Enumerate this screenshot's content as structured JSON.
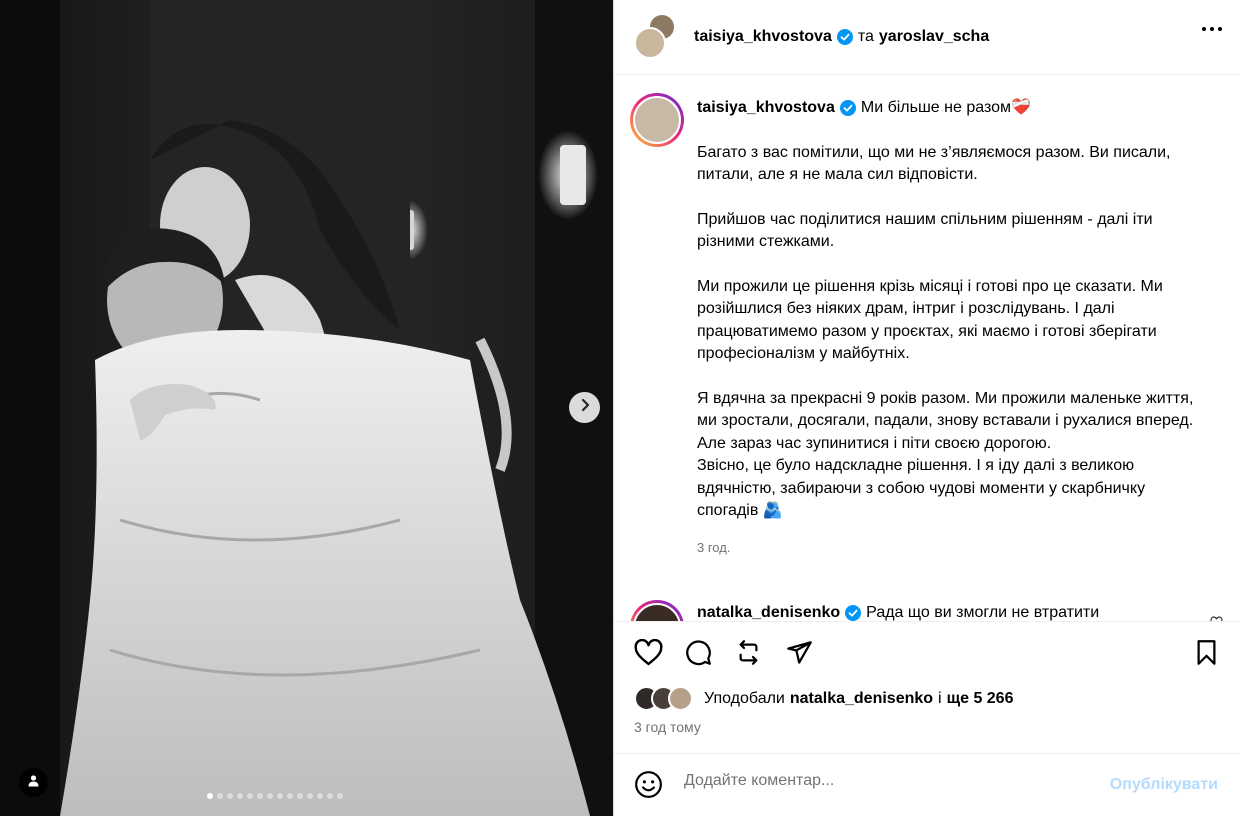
{
  "post": {
    "author": "taisiya_khvostova",
    "conjunction": "та",
    "coauthor": "yaroslav_scha"
  },
  "caption": {
    "username": "taisiya_khvostova",
    "first_line": "Ми більше не разом",
    "first_emoji": "❤️‍🩹",
    "paragraphs": [
      "Багато з вас помітили, що ми не з’являємося разом. Ви писали, питали, але я не мала сил відповісти.",
      "Прийшов час поділитися нашим спільним рішенням - далі іти різними стежками.",
      "Ми прожили це рішення крізь місяці і готові про це сказати. Ми розійшлися без ніяких драм, інтриг і розслідувань. І далі працюватимемо разом у проєктах, які маємо і готові зберігати професіоналізм у майбутніх.",
      "Я вдячна за прекрасні 9 років разом. Ми прожили маленьке життя, ми зростали, досягали, падали, знову вставали і рухалися вперед. Але зараз час зупинитися і піти своєю дорогою."
    ],
    "last_paragraph": "Звісно, це було надскладне рішення. І я іду далі з великою вдячністю, забираючи з собою чудові моменти у скарбничку спогадів",
    "last_emoji": "🫂",
    "time": "3 год."
  },
  "comment": {
    "username": "natalka_denisenko",
    "text": "Рада що ви змогли не втратити"
  },
  "likes": {
    "prefix": "Уподобали",
    "user": "natalka_denisenko",
    "mid": "і",
    "count": "ще 5 266"
  },
  "timestamp": "3 год тому",
  "comment_bar": {
    "placeholder": "Додайте коментар...",
    "post_label": "Опублікувати"
  },
  "carousel": {
    "total": 14,
    "active": 0
  },
  "colors": {
    "verified": "#0095f6",
    "post_button": "#b3dbff",
    "secondary_text": "#737373"
  },
  "icons": [
    "verified-badge-icon",
    "more-options-icon",
    "heart-icon",
    "comment-icon",
    "repost-icon",
    "share-icon",
    "bookmark-icon",
    "emoji-icon",
    "chevron-right-icon",
    "user-tag-icon"
  ]
}
